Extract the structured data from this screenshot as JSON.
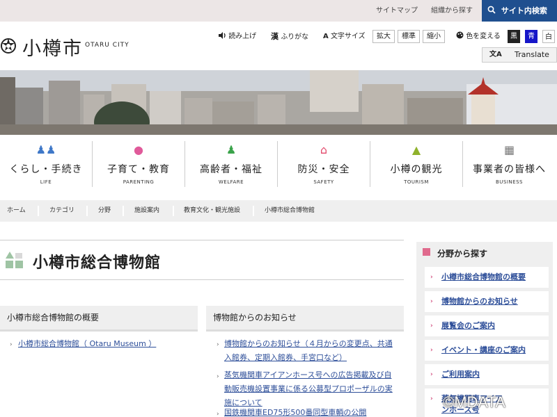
{
  "topbar": {
    "sitemap": "サイトマップ",
    "by_org": "組織から探す",
    "site_search": "サイト内検索"
  },
  "header": {
    "city_name": "小樽市",
    "city_name_en": "OTARU CITY",
    "read_aloud": "読み上げ",
    "furigana": "ふりがな",
    "text_size": "文字サイズ",
    "size_large": "拡大",
    "size_standard": "標準",
    "size_small": "縮小",
    "change_color": "色を変える",
    "color_black": "黒",
    "color_blue": "青",
    "color_white": "白",
    "translate": "Translate",
    "colors": {
      "accent": "#1f4f8f",
      "black": "#222222",
      "blue": "#1616c8",
      "white": "#ffffff"
    }
  },
  "nav": [
    {
      "icon": "family-icon",
      "label": "くらし・手続き",
      "label_en": "LIFE"
    },
    {
      "icon": "stroller-icon",
      "label": "子育て・教育",
      "label_en": "PARENTING"
    },
    {
      "icon": "elder-walking-icon",
      "label": "高齢者・福祉",
      "label_en": "WELFARE"
    },
    {
      "icon": "house-shield-icon",
      "label": "防災・安全",
      "label_en": "SAFETY"
    },
    {
      "icon": "gaslamp-icon",
      "label": "小樽の観光",
      "label_en": "TOURISM"
    },
    {
      "icon": "building-icon",
      "label": "事業者の皆様へ",
      "label_en": "BUSINESS"
    }
  ],
  "breadcrumb": [
    "ホーム",
    "カテゴリ",
    "分野",
    "施設案内",
    "教育文化・観光施設",
    "小樽市総合博物館"
  ],
  "page_title": "小樽市総合博物館",
  "overview": {
    "heading": "小樽市総合博物館の概要",
    "links": [
      "小樽市総合博物館（ Otaru Museum ）"
    ]
  },
  "news": {
    "heading": "博物館からのお知らせ",
    "links": [
      "博物館からのお知らせ（４月からの変更点、共通入館券、定期入館券、手宮口など）",
      "蒸気機関車アイアンホース号への広告掲載及び自動販売機設置事業に係る公募型プロポーザルの実施について",
      "国鉄機関車ED75形500番同型車輌の公開"
    ]
  },
  "sidebar": {
    "heading": "分野から探す",
    "items": [
      "小樽市総合博物館の概要",
      "博物館からのお知らせ",
      "展覧会のご案内",
      "イベント・講座のご案内",
      "ご利用案内",
      "蒸気機関車アイアンホース号"
    ]
  },
  "watermark": "©MDATA"
}
